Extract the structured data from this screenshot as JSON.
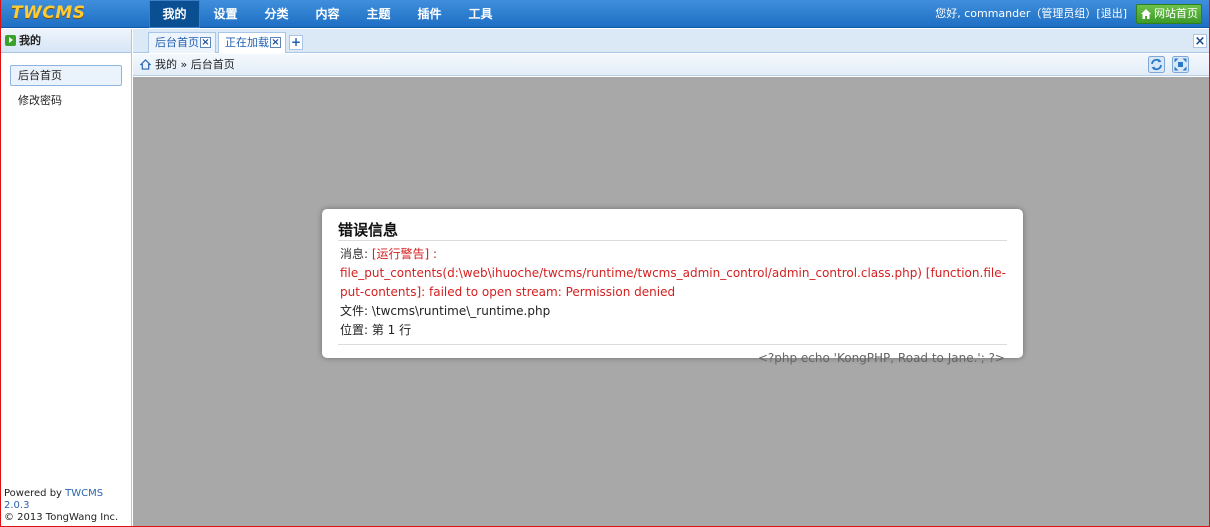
{
  "app": {
    "logo": "TWCMS"
  },
  "nav": {
    "items": [
      {
        "label": "我的",
        "active": true
      },
      {
        "label": "设置",
        "active": false
      },
      {
        "label": "分类",
        "active": false
      },
      {
        "label": "内容",
        "active": false
      },
      {
        "label": "主题",
        "active": false
      },
      {
        "label": "插件",
        "active": false
      },
      {
        "label": "工具",
        "active": false
      }
    ]
  },
  "user": {
    "greeting": "您好, commander（管理员组）",
    "logout": "[退出]",
    "home_button": "网站首页"
  },
  "sidebar": {
    "title": "我的",
    "items": [
      {
        "label": "后台首页",
        "active": true
      },
      {
        "label": "修改密码",
        "active": false
      }
    ],
    "footer_prefix": "Powered by ",
    "footer_brand": "TWCMS 2.0.3",
    "footer_copyright": "© 2013 TongWang Inc."
  },
  "tabs": [
    {
      "label": "后台首页",
      "close": "×"
    },
    {
      "label": "正在加载",
      "close": "×"
    }
  ],
  "tab_add": "+",
  "tab_close_all": "×",
  "breadcrumb": "我的 » 后台首页",
  "dialog": {
    "title": "错误信息",
    "message_label": "消息: ",
    "message_tag": "[运行警告]",
    "message_text": " : file_put_contents(d:\\web\\ihuoche/twcms/runtime/twcms_admin_control/admin_control.class.php) [function.file-put-contents]: failed to open stream: Permission denied",
    "file_line": "文件: \\twcms\\runtime\\_runtime.php",
    "position_line": "位置: 第 1 行",
    "footer": "<?php echo 'KongPHP, Road to Jane.'; ?>"
  },
  "colors": {
    "nav_bg": "#1e6fc4",
    "accent_red": "#d41f1f",
    "content_bg": "#a8a8a8",
    "home_green": "#3d9a27"
  }
}
